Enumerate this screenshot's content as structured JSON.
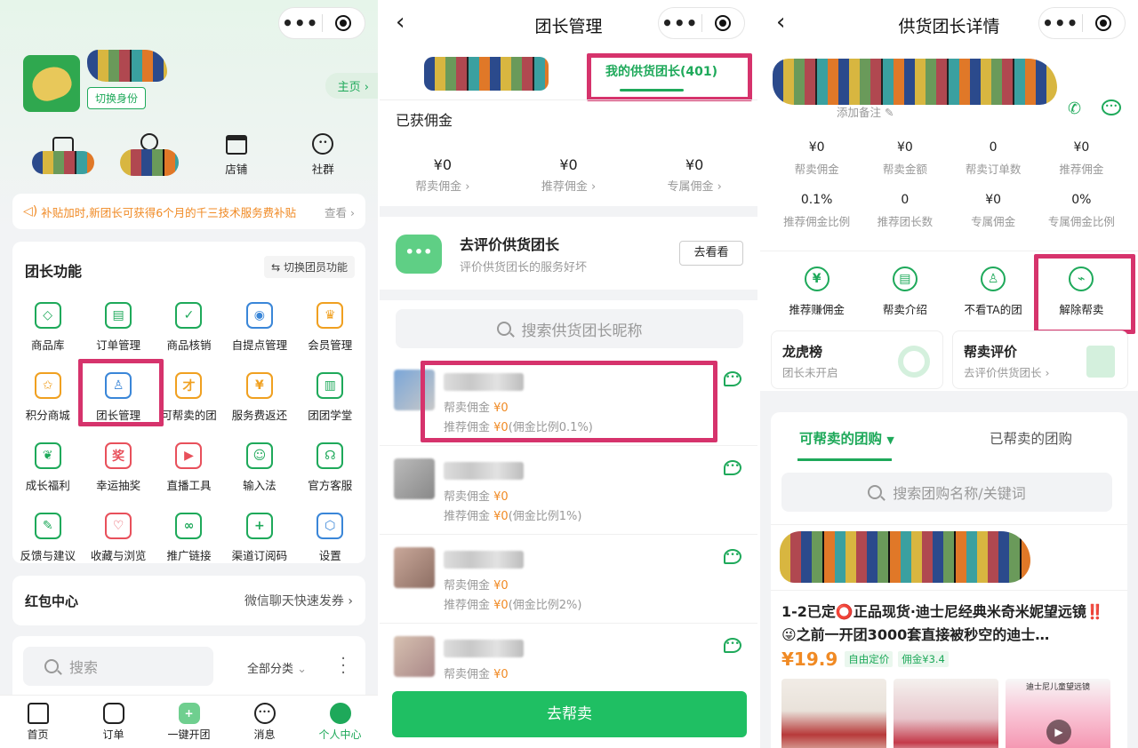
{
  "p1": {
    "switch_identity": "切换身份",
    "home_link": "主页 ›",
    "top_icons": [
      {
        "label": ""
      },
      {
        "label": ""
      },
      {
        "label": "店铺"
      },
      {
        "label": "社群"
      }
    ],
    "notice": "补贴加时,新团长可获得6个月的千三技术服务费补贴",
    "notice_link": "查看 ›",
    "section_title": "团长功能",
    "switch_member": "⇆ 切换团员功能",
    "functions": [
      {
        "label": "商品库",
        "icon": "cube-icon"
      },
      {
        "label": "订单管理",
        "icon": "order-icon"
      },
      {
        "label": "商品核销",
        "icon": "verify-icon"
      },
      {
        "label": "自提点管理",
        "icon": "pickup-pin-icon"
      },
      {
        "label": "会员管理",
        "icon": "crown-icon"
      },
      {
        "label": "积分商城",
        "icon": "points-icon"
      },
      {
        "label": "团长管理",
        "icon": "leader-icon"
      },
      {
        "label": "可帮卖的团",
        "icon": "group-sell-icon"
      },
      {
        "label": "服务费返还",
        "icon": "fee-refund-icon"
      },
      {
        "label": "团团学堂",
        "icon": "book-icon"
      },
      {
        "label": "成长福利",
        "icon": "leaf-icon"
      },
      {
        "label": "幸运抽奖",
        "icon": "lottery-icon"
      },
      {
        "label": "直播工具",
        "icon": "live-icon"
      },
      {
        "label": "输入法",
        "icon": "input-method-icon"
      },
      {
        "label": "官方客服",
        "icon": "headset-icon"
      },
      {
        "label": "反馈与建议",
        "icon": "feedback-icon"
      },
      {
        "label": "收藏与浏览",
        "icon": "heart-icon"
      },
      {
        "label": "推广链接",
        "icon": "link-icon"
      },
      {
        "label": "渠道订阅码",
        "icon": "qrcode-icon"
      },
      {
        "label": "设置",
        "icon": "settings-icon"
      }
    ],
    "redpacket_title": "红包中心",
    "redpacket_link": "微信聊天快速发券 ›",
    "search_placeholder": "搜索",
    "category": "全部分类",
    "tabs": [
      {
        "label": "首页"
      },
      {
        "label": "订单"
      },
      {
        "label": "一键开团"
      },
      {
        "label": "消息"
      },
      {
        "label": "个人中心"
      }
    ]
  },
  "p2": {
    "title": "团长管理",
    "tab_mine": "我的供货团长(401)",
    "earned_title": "已获佣金",
    "stats": [
      {
        "value": "¥0",
        "label": "帮卖佣金 ›"
      },
      {
        "value": "¥0",
        "label": "推荐佣金 ›"
      },
      {
        "value": "¥0",
        "label": "专属佣金 ›"
      }
    ],
    "review_title": "去评价供货团长",
    "review_sub": "评价供货团长的服务好坏",
    "review_btn": "去看看",
    "search_placeholder": "搜索供货团长昵称",
    "rows": [
      {
        "l1_label": "帮卖佣金",
        "l1_val": "¥0",
        "l2_label": "推荐佣金",
        "l2_val": "¥0",
        "l2_note": "(佣金比例0.1%)"
      },
      {
        "l1_label": "帮卖佣金",
        "l1_val": "¥0",
        "l2_label": "推荐佣金",
        "l2_val": "¥0",
        "l2_note": "(佣金比例1%)"
      },
      {
        "l1_label": "帮卖佣金",
        "l1_val": "¥0",
        "l2_label": "推荐佣金",
        "l2_val": "¥0",
        "l2_note": "(佣金比例2%)"
      },
      {
        "l1_label": "帮卖佣金",
        "l1_val": "¥0",
        "l2_label": "",
        "l2_val": "",
        "l2_note": ""
      }
    ],
    "bottom_btn": "去帮卖"
  },
  "p3": {
    "title": "供货团长详情",
    "add_note": "添加备注",
    "stats": [
      {
        "v": "¥0",
        "k": "帮卖佣金"
      },
      {
        "v": "¥0",
        "k": "帮卖金额"
      },
      {
        "v": "0",
        "k": "帮卖订单数"
      },
      {
        "v": "¥0",
        "k": "推荐佣金"
      },
      {
        "v": "0.1%",
        "k": "推荐佣金比例"
      },
      {
        "v": "0",
        "k": "推荐团长数"
      },
      {
        "v": "¥0",
        "k": "专属佣金"
      },
      {
        "v": "0%",
        "k": "专属佣金比例"
      }
    ],
    "actions": [
      {
        "label": "推荐赚佣金",
        "icon": "yen-icon"
      },
      {
        "label": "帮卖介绍",
        "icon": "clipboard-icon"
      },
      {
        "label": "不看TA的团",
        "icon": "hide-user-icon"
      },
      {
        "label": "解除帮卖",
        "icon": "unlink-icon"
      }
    ],
    "ranking_title": "龙虎榜",
    "ranking_sub": "团长未开启",
    "review_title": "帮卖评价",
    "review_sub": "去评价供货团长 ›",
    "tab_can": "可帮卖的团购",
    "tab_done": "已帮卖的团购",
    "search_placeholder": "搜索团购名称/关键词",
    "product_title": "1-2已定⭕正品现货·迪士尼经典米奇米妮望远镜‼️ 😜之前一开团3000套直接被秒空的迪士…",
    "price": "¥19.9",
    "tag_price": "自由定价",
    "tag_commission": "佣金¥3.4",
    "thumb_text": "迪士尼儿童望远镜"
  }
}
